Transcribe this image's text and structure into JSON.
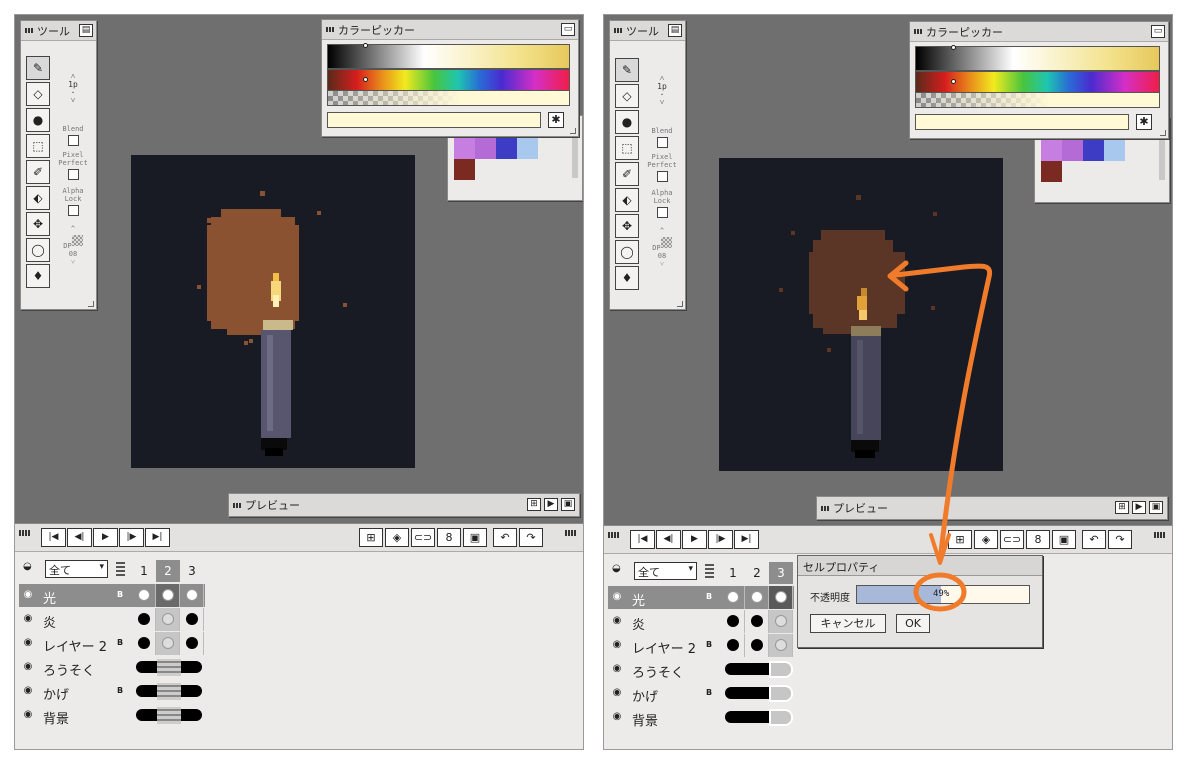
{
  "panels": {
    "tools_title": "ツール",
    "color_picker_title": "カラーピッカー",
    "preview_title": "プレビュー"
  },
  "tool_options": {
    "brush_size": "1p",
    "blend_label": "Blend",
    "pixel_perfect_label": "Pixel Perfect",
    "alpha_lock_label": "Alpha Lock",
    "dp_label": "DP",
    "dp_value": "08"
  },
  "color_picker": {
    "hex_button": "✱"
  },
  "palette": [
    "#c67ee0",
    "#b46bd6",
    "#3d3cc4",
    "#a8c8ee",
    "#7b2a22"
  ],
  "canvas": {
    "background": "#181b24"
  },
  "timeline": {
    "filter_value": "全て",
    "frames": [
      "1",
      "2",
      "3"
    ],
    "layers_left": [
      {
        "name": "光",
        "blend_badge": "B"
      },
      {
        "name": "炎",
        "blend_badge": ""
      },
      {
        "name": "レイヤー 2",
        "blend_badge": "B"
      },
      {
        "name": "ろうそく",
        "blend_badge": ""
      },
      {
        "name": "かげ",
        "blend_badge": "B"
      },
      {
        "name": "背景",
        "blend_badge": ""
      }
    ],
    "layers_right": [
      {
        "name": "光",
        "blend_badge": "B"
      },
      {
        "name": "炎",
        "blend_badge": ""
      },
      {
        "name": "レイヤー 2",
        "blend_badge": "B"
      },
      {
        "name": "ろうそく",
        "blend_badge": ""
      },
      {
        "name": "かげ",
        "blend_badge": "B"
      },
      {
        "name": "背景",
        "blend_badge": ""
      }
    ]
  },
  "cell_dialog": {
    "title": "セルプロパティ",
    "opacity_label": "不透明度",
    "opacity_value": "49%",
    "cancel_label": "キャンセル",
    "ok_label": "OK"
  },
  "colors": {
    "workspace": "#6f6f6f",
    "candle_glow": "#7a4a2a",
    "annotation": "#f07b2a"
  }
}
